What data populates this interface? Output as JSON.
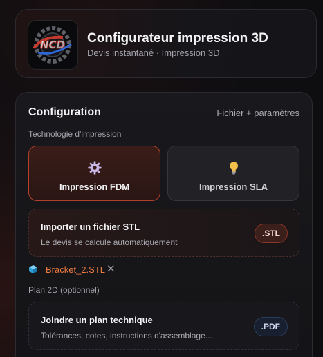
{
  "header": {
    "logo_text": "NCD",
    "title": "Configurateur impression 3D",
    "subtitle": "Devis instantané · Impression 3D"
  },
  "config": {
    "title": "Configuration",
    "hint": "Fichier + paramètres",
    "tech_label": "Technologie d'impression",
    "options": [
      {
        "label": "Impression FDM",
        "icon": "gear-icon",
        "selected": true
      },
      {
        "label": "Impression SLA",
        "icon": "lightbulb-icon",
        "selected": false
      }
    ],
    "stl_upload": {
      "title": "Importer un fichier STL",
      "description": "Le devis se calcule automatiquement",
      "badge": ".STL"
    },
    "attached_file": {
      "name": "Bracket_2.STL",
      "remove_symbol": "✕"
    },
    "plan_label": "Plan 2D (optionnel)",
    "plan_upload": {
      "title": "Joindre un plan technique",
      "description": "Tolérances, cotes, instructions d'assemblage...",
      "badge": ".PDF"
    }
  },
  "colors": {
    "accent": "#ef7a3f",
    "selected_border": "#b4402c",
    "pdf_accent": "#2b3d5e"
  }
}
